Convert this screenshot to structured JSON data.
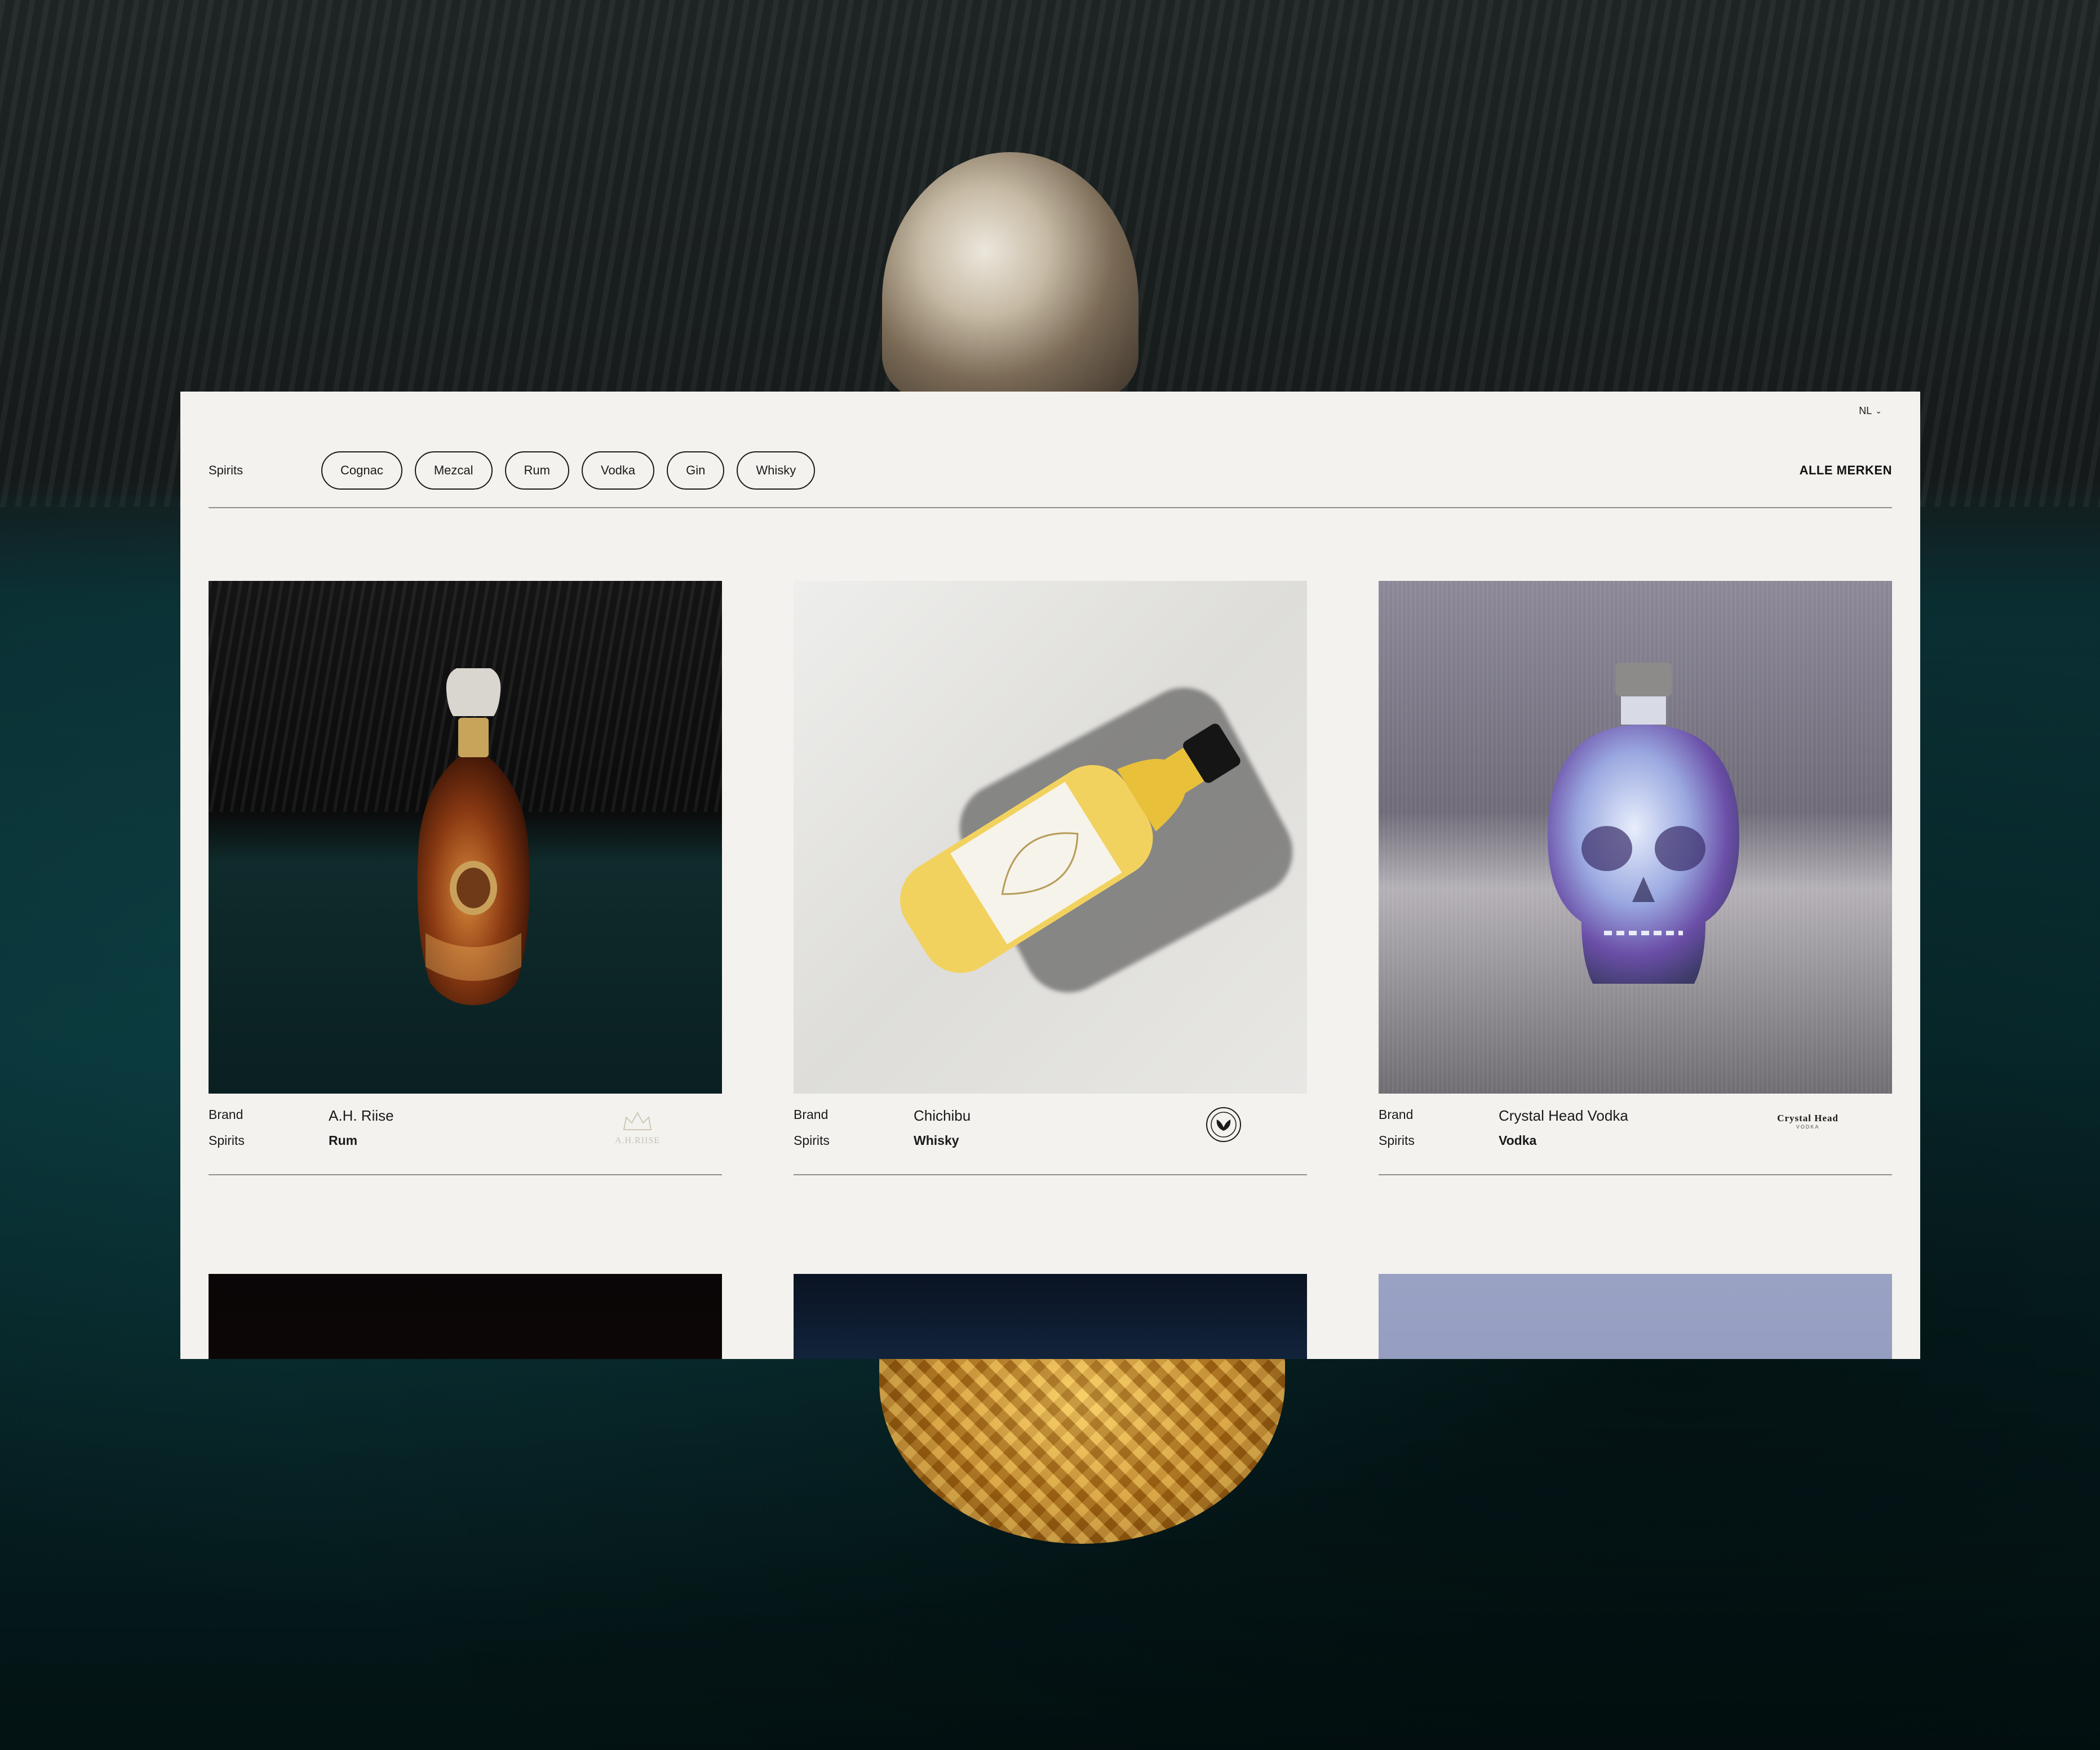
{
  "header": {
    "language": "NL",
    "section_label": "Spirits",
    "categories": [
      "Cognac",
      "Mezcal",
      "Rum",
      "Vodka",
      "Gin",
      "Whisky"
    ],
    "all_brands_label": "ALLE MERKEN"
  },
  "products": [
    {
      "brand_key": "Brand",
      "brand": "A.H. Riise",
      "spirit_key": "Spirits",
      "spirit": "Rum",
      "logo_text": "A.H.RIISE"
    },
    {
      "brand_key": "Brand",
      "brand": "Chichibu",
      "spirit_key": "Spirits",
      "spirit": "Whisky"
    },
    {
      "brand_key": "Brand",
      "brand": "Crystal Head Vodka",
      "spirit_key": "Spirits",
      "spirit": "Vodka",
      "logo_text": "Crystal Head",
      "logo_sub": "VODKA"
    }
  ],
  "colors": {
    "panel_bg": "#f3f2ee",
    "text": "#1a1a1a",
    "rule": "#8e8e8a"
  }
}
